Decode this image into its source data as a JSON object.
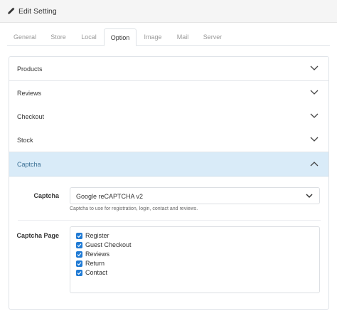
{
  "header": {
    "title": "Edit Setting",
    "icon": "pencil-icon"
  },
  "tabs": [
    {
      "label": "General"
    },
    {
      "label": "Store"
    },
    {
      "label": "Local"
    },
    {
      "label": "Option",
      "active": true
    },
    {
      "label": "Image"
    },
    {
      "label": "Mail"
    },
    {
      "label": "Server"
    }
  ],
  "accordion": {
    "sections": [
      {
        "label": "Products",
        "expanded": false
      },
      {
        "label": "Reviews",
        "expanded": false
      },
      {
        "label": "Checkout",
        "expanded": false
      },
      {
        "label": "Stock",
        "expanded": false
      },
      {
        "label": "Captcha",
        "expanded": true
      }
    ]
  },
  "captcha": {
    "captcha_label": "Captcha",
    "captcha_value": "Google reCAPTCHA v2",
    "captcha_help": "Captcha to use for registration, login, contact and reviews.",
    "page_label": "Captcha Page",
    "pages": [
      {
        "label": "Register",
        "checked": true
      },
      {
        "label": "Guest Checkout",
        "checked": true
      },
      {
        "label": "Reviews",
        "checked": true
      },
      {
        "label": "Return",
        "checked": true
      },
      {
        "label": "Contact",
        "checked": true
      }
    ]
  },
  "colors": {
    "accent": "#1f7ad4",
    "active_section_bg": "#d9ebf8",
    "active_section_text": "#3a6f94"
  }
}
